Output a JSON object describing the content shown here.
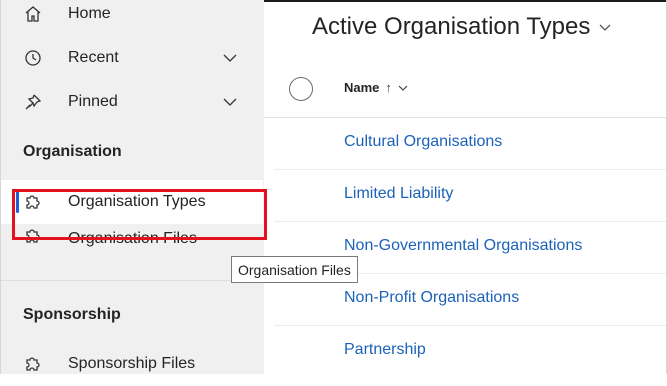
{
  "sidebar": {
    "items_top": [
      {
        "label": "Home",
        "icon": "home-icon"
      },
      {
        "label": "Recent",
        "icon": "clock-icon",
        "expandable": true
      },
      {
        "label": "Pinned",
        "icon": "pin-icon",
        "expandable": true
      }
    ],
    "section_organisation": "Organisation",
    "organisation_items": [
      {
        "label": "Organisation Types",
        "icon": "puzzle-icon",
        "selected": true
      },
      {
        "label": "Organisation Files",
        "icon": "puzzle-icon"
      }
    ],
    "section_sponsorship": "Sponsorship",
    "sponsorship_items": [
      {
        "label": "Sponsorship Files",
        "icon": "puzzle-icon"
      }
    ]
  },
  "tooltip": {
    "text": "Organisation Files"
  },
  "main": {
    "title": "Active Organisation Types",
    "column_header": "Name",
    "sort_indicator": "↑",
    "rows": [
      "Cultural Organisations",
      "Limited Liability",
      "Non-Governmental Organisations",
      "Non-Profit Organisations",
      "Partnership"
    ]
  },
  "colors": {
    "accent_link": "#1c62b9",
    "selection_bar": "#1d5fd6",
    "highlight_box": "#e3121e",
    "sidebar_bg": "#f0f0f0"
  }
}
